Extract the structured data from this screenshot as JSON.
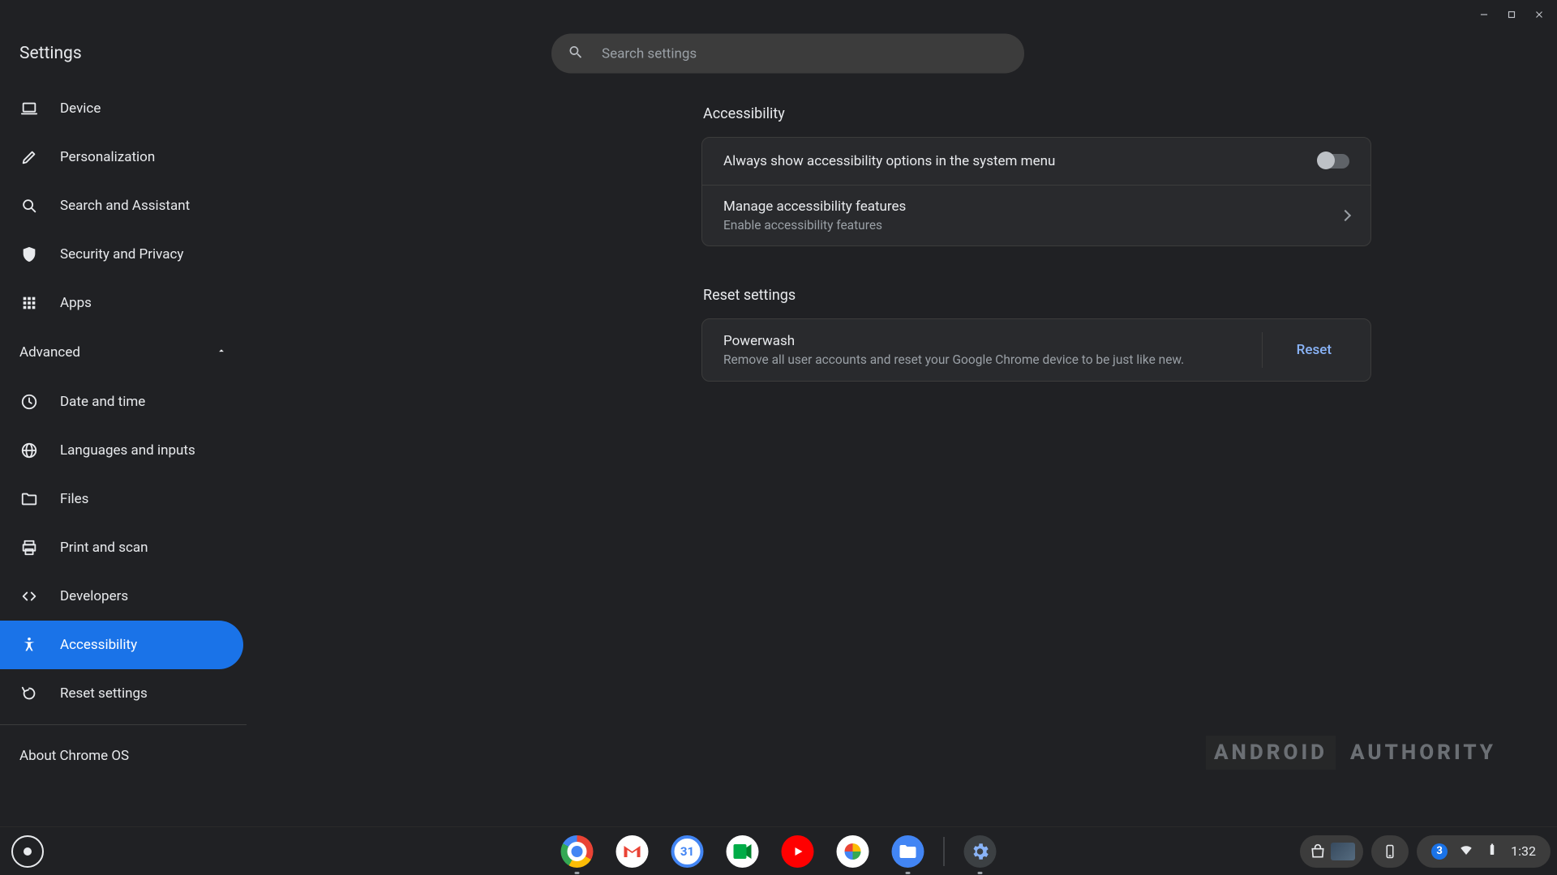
{
  "header": {
    "title": "Settings",
    "search_placeholder": "Search settings"
  },
  "sidebar": {
    "items": [
      {
        "label": "Device"
      },
      {
        "label": "Personalization"
      },
      {
        "label": "Search and Assistant"
      },
      {
        "label": "Security and Privacy"
      },
      {
        "label": "Apps"
      }
    ],
    "advanced_label": "Advanced",
    "advanced_items": [
      {
        "label": "Date and time"
      },
      {
        "label": "Languages and inputs"
      },
      {
        "label": "Files"
      },
      {
        "label": "Print and scan"
      },
      {
        "label": "Developers"
      },
      {
        "label": "Accessibility"
      },
      {
        "label": "Reset settings"
      }
    ],
    "about_label": "About Chrome OS"
  },
  "content": {
    "accessibility": {
      "heading": "Accessibility",
      "toggle_row": "Always show accessibility options in the system menu",
      "manage_title": "Manage accessibility features",
      "manage_sub": "Enable accessibility features"
    },
    "reset": {
      "heading": "Reset settings",
      "powerwash_title": "Powerwash",
      "powerwash_sub": "Remove all user accounts and reset your Google Chrome device to be just like new.",
      "reset_button": "Reset"
    }
  },
  "watermark": {
    "a": "ANDROID",
    "b": "AUTHORITY"
  },
  "tray": {
    "notification_count": "3",
    "time": "1:32"
  }
}
